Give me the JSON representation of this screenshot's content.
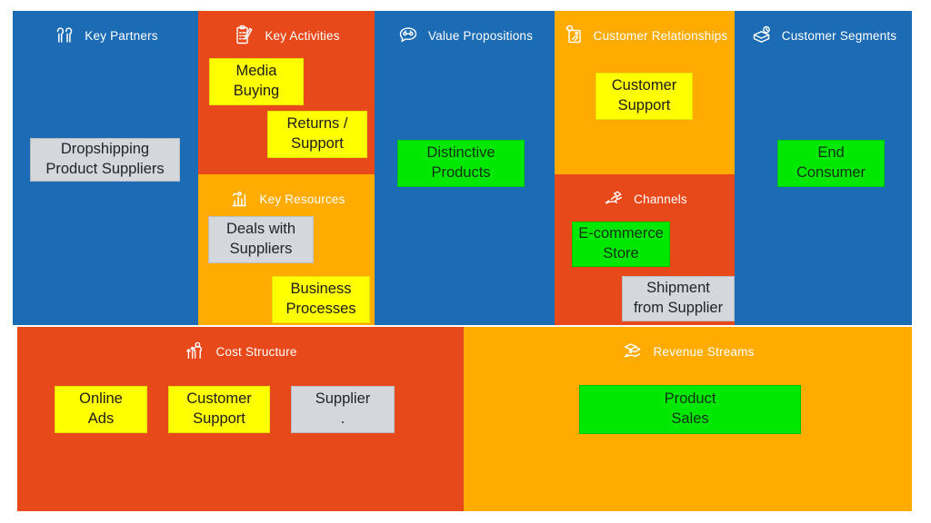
{
  "canvas": {
    "title": "Business Model Canvas",
    "colors": {
      "blue": "#1b6cb5",
      "orange_red": "#e8491b",
      "amber": "#ffab00",
      "yellow_note": "#ffff00",
      "green_note": "#00e800",
      "grey_note": "#d4d7dc",
      "header_text": "#ffffff",
      "page_background": "#ffffff"
    }
  },
  "blocks": {
    "key_partners": {
      "title": "Key Partners",
      "icon": "two-people-icon",
      "background": "#1b6cb5",
      "notes": [
        {
          "lines": [
            "Dropshipping",
            "Product Suppliers"
          ],
          "color": "grey"
        }
      ]
    },
    "key_activities": {
      "title": "Key Activities",
      "icon": "clipboard-checklist-icon",
      "background": "#e8491b",
      "notes": [
        {
          "lines": [
            "Media",
            "Buying"
          ],
          "color": "yellow"
        },
        {
          "lines": [
            "Returns /",
            "Support"
          ],
          "color": "yellow"
        }
      ]
    },
    "key_resources": {
      "title": "Key Resources",
      "icon": "bar-chart-icon",
      "background": "#ffab00",
      "notes": [
        {
          "lines": [
            "Deals with",
            "Suppliers"
          ],
          "color": "grey"
        },
        {
          "lines": [
            "Business",
            "Processes"
          ],
          "color": "yellow"
        }
      ]
    },
    "value_propositions": {
      "title": "Value Propositions",
      "icon": "speech-bubble-icon",
      "background": "#1b6cb5",
      "notes": [
        {
          "lines": [
            "Distinctive",
            "Products"
          ],
          "color": "green"
        }
      ]
    },
    "customer_relationships": {
      "title": "Customer Relationships",
      "icon": "heart-frame-icon",
      "background": "#ffab00",
      "notes": [
        {
          "lines": [
            "Customer",
            "Support"
          ],
          "color": "yellow"
        }
      ]
    },
    "channels": {
      "title": "Channels",
      "icon": "delivery-hand-icon",
      "background": "#e8491b",
      "notes": [
        {
          "lines": [
            "E-commerce",
            "Store"
          ],
          "color": "green"
        },
        {
          "lines": [
            "Shipment",
            "from Supplier"
          ],
          "color": "grey"
        }
      ]
    },
    "customer_segments": {
      "title": "Customer Segments",
      "icon": "segments-layers-icon",
      "background": "#1b6cb5",
      "notes": [
        {
          "lines": [
            "End",
            "Consumer"
          ],
          "color": "green"
        }
      ]
    },
    "cost_structure": {
      "title": "Cost Structure",
      "icon": "cost-person-arrows-icon",
      "background": "#e8491b",
      "notes": [
        {
          "lines": [
            "Online",
            "Ads"
          ],
          "color": "yellow"
        },
        {
          "lines": [
            "Customer",
            "Support"
          ],
          "color": "yellow"
        },
        {
          "lines": [
            "Supplier",
            "."
          ],
          "color": "grey"
        }
      ]
    },
    "revenue_streams": {
      "title": "Revenue Streams",
      "icon": "money-hand-icon",
      "background": "#ffab00",
      "notes": [
        {
          "lines": [
            "Product",
            "Sales"
          ],
          "color": "green"
        }
      ]
    }
  }
}
